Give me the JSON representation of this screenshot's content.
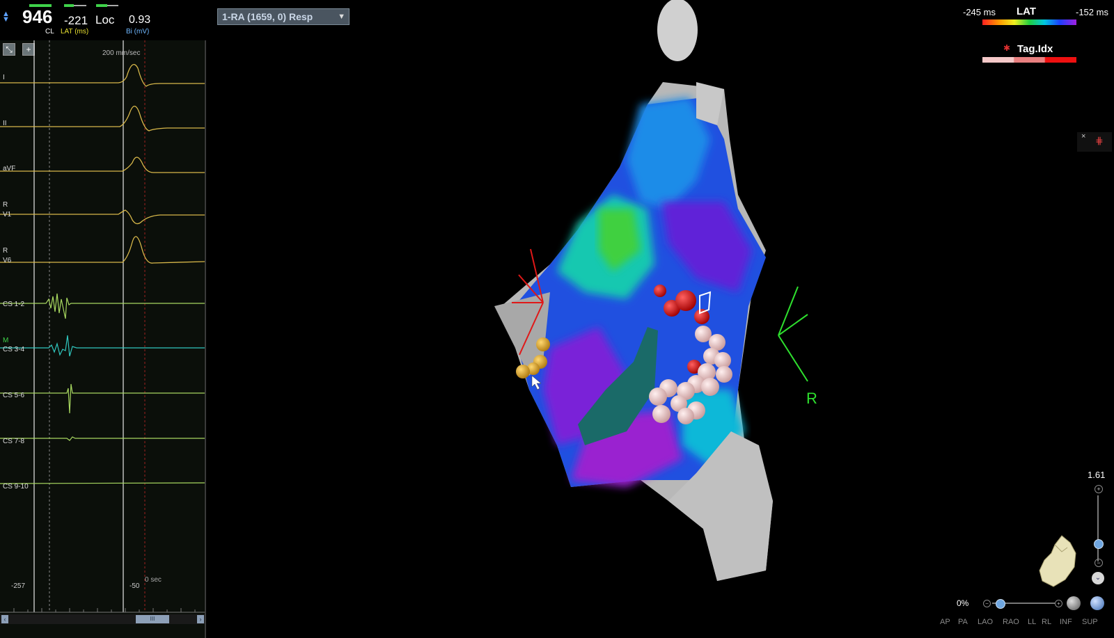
{
  "header": {
    "cl_value": "946",
    "cl_label": "CL",
    "lat_value": "-221",
    "lat_label": "LAT (ms)",
    "loc_label": "Loc",
    "bi_value": "0.93",
    "bi_label": "Bi (mV)"
  },
  "ecg": {
    "speed_label": "200 mm/sec",
    "leads": [
      "I",
      "II",
      "aVF",
      "R",
      "V1",
      "R",
      "V6",
      "CS 1-2",
      "M",
      "CS 3-4",
      "CS 5-6",
      "CS 7-8",
      "CS 9-10"
    ],
    "window_left": "-257",
    "window_right": "-50",
    "time_label": "0 sec",
    "scroll_thumb": "III"
  },
  "map_selector": {
    "label": "1-RA (1659, 0) Resp"
  },
  "legend": {
    "lat_min": "-245 ms",
    "lat_title": "LAT",
    "lat_max": "-152 ms",
    "tag_title": "Tag.Idx",
    "close_glyph": "×"
  },
  "orientation_label": "R",
  "zoom": {
    "value": "1.61",
    "opacity": "0%"
  },
  "view_buttons": [
    "AP",
    "PA",
    "LAO",
    "RAO",
    "LL",
    "RL",
    "INF",
    "SUP"
  ],
  "colors": {
    "ecg_surface": "#d8b84a",
    "ecg_cs": "#a8d860",
    "ecg_cs_map": "#30c8c0",
    "accent": "#3fd24a"
  },
  "icons": [
    "reset-view-icon",
    "add-view-icon",
    "tag-icon",
    "close-icon",
    "zoom-in-icon",
    "zoom-out-icon",
    "heart-orientation-icon",
    "rotate-icon",
    "settings-icon"
  ]
}
